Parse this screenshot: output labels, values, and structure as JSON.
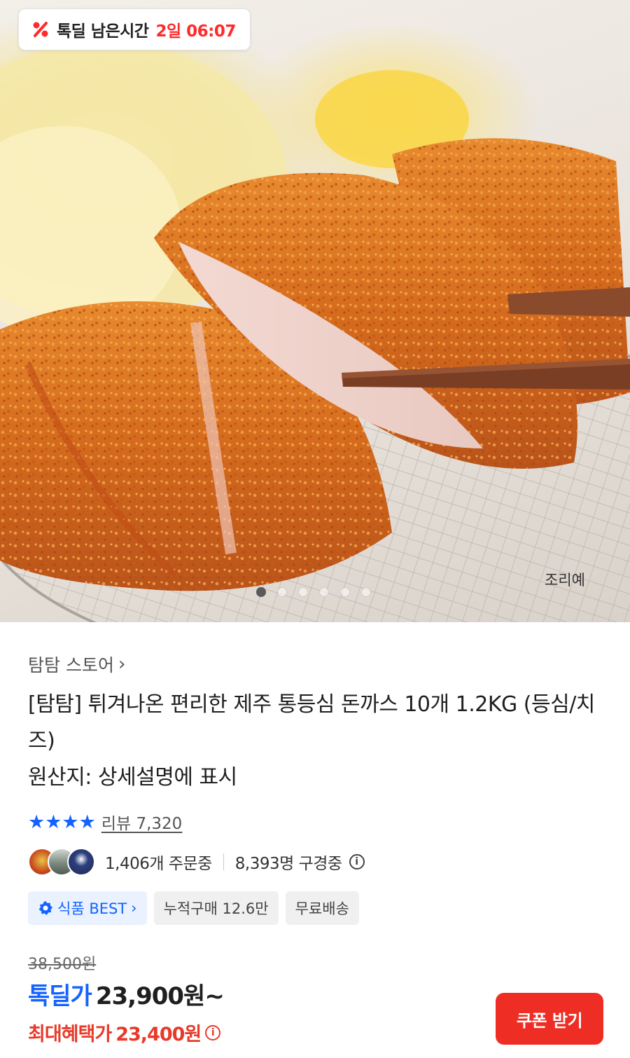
{
  "hero": {
    "timer_label": "톡딜 남은시간",
    "timer_value": "2일 06:07",
    "caption": "조리예",
    "page_count": 6,
    "active_index": 0
  },
  "product": {
    "store_name": "탐탐 스토어",
    "title": "[탐탐] 튀겨나온 편리한 제주 통등심 돈까스 10개 1.2KG (등심/치즈)",
    "origin": "원산지: 상세설명에 표시",
    "rating_stars": 4,
    "review_label": "리뷰 7,320",
    "orders": "1,406개 주문중",
    "watchers": "8,393명 구경중",
    "tags": {
      "best": "식품 BEST",
      "cumulative": "누적구매 12.6만",
      "shipping": "무료배송"
    }
  },
  "price": {
    "original": "38,500원",
    "deal_label": "톡딜가",
    "deal_price": "23,900원~",
    "max_label": "최대혜택가",
    "max_price": "23,400원"
  },
  "actions": {
    "coupon_button": "쿠폰 받기"
  },
  "colors": {
    "accent_blue": "#1463ff",
    "accent_red": "#ee2e24",
    "timer_red": "#ff2a2a"
  }
}
